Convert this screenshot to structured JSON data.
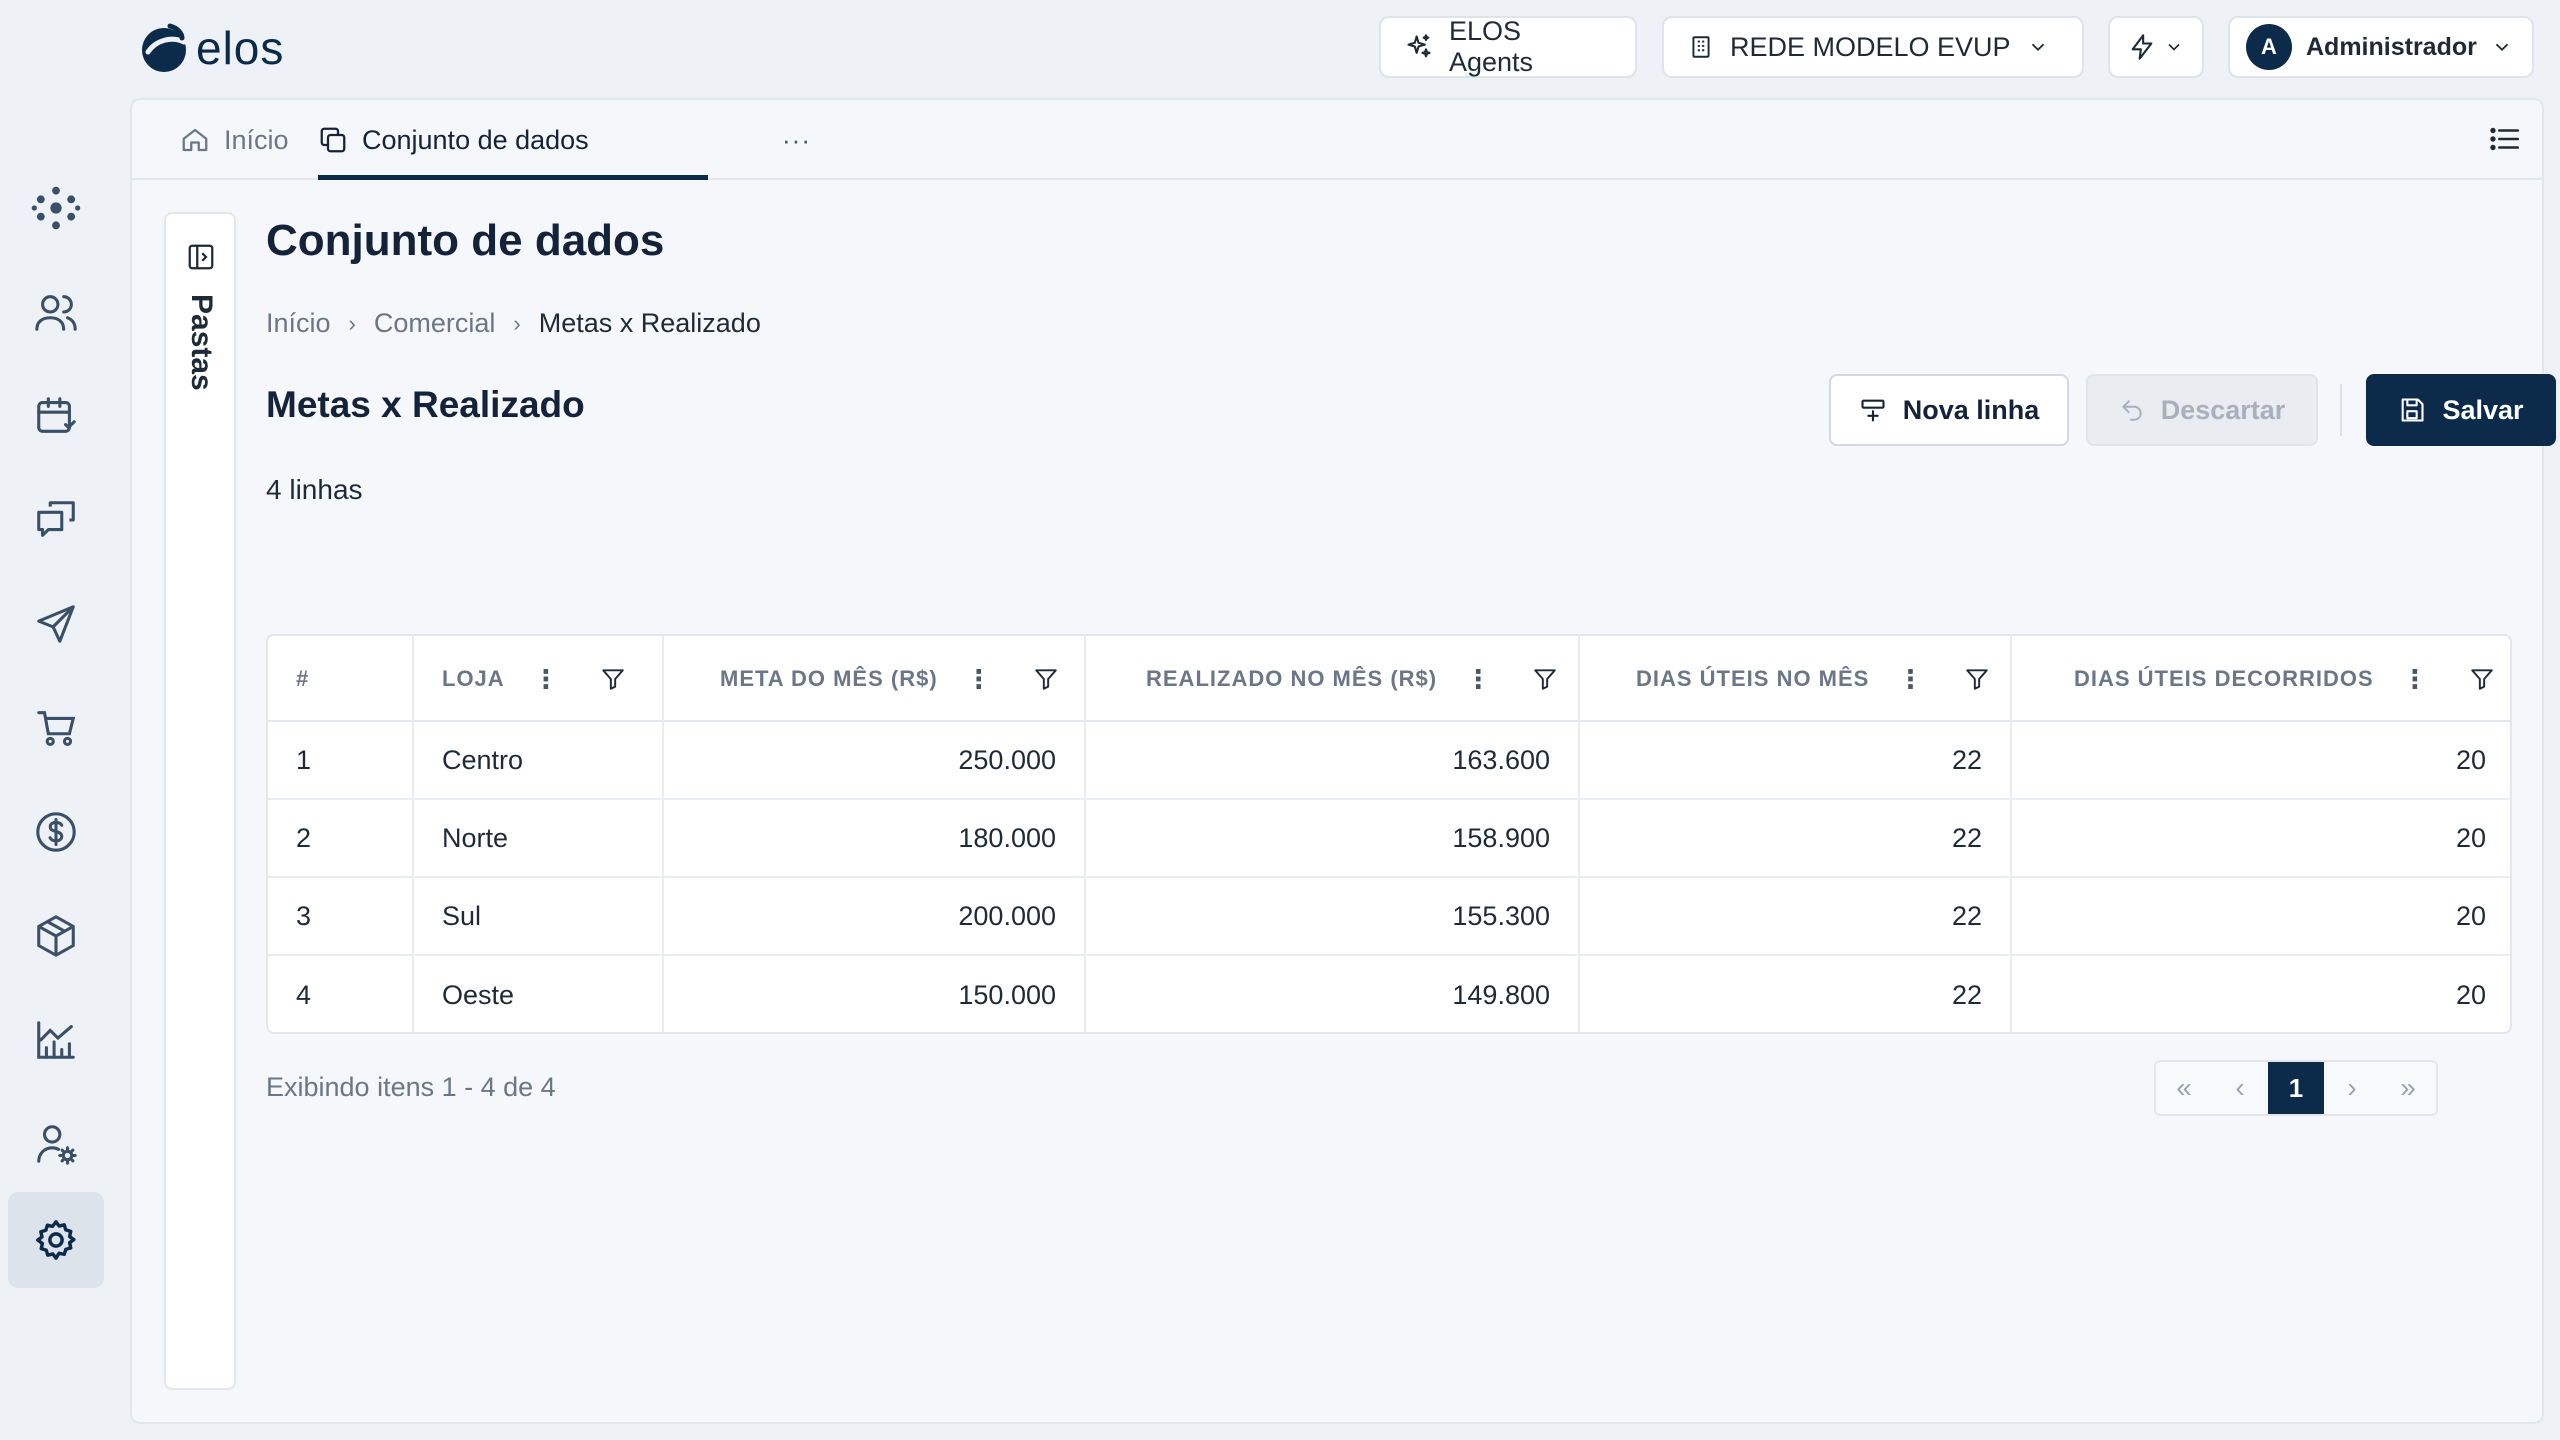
{
  "brand": {
    "name": "elos"
  },
  "topbar": {
    "agents_label": "ELOS Agents",
    "network_label": "REDE MODELO EVUP",
    "user_initial": "A",
    "user_name": "Administrador"
  },
  "rail": {
    "items": [
      "network-icon",
      "users-icon",
      "calendar-icon",
      "chat-icon",
      "send-icon",
      "cart-icon",
      "dollar-icon",
      "box-icon",
      "analytics-icon",
      "user-settings-icon",
      "gear-icon"
    ],
    "active": "gear-icon"
  },
  "tabs": {
    "home_label": "Início",
    "dataset_label": "Conjunto de dados",
    "more_label": "···"
  },
  "folders": {
    "label": "Pastas"
  },
  "page": {
    "title": "Conjunto de dados",
    "breadcrumb": [
      "Início",
      "Comercial",
      "Metas x Realizado"
    ],
    "section_title": "Metas x Realizado",
    "row_count": "4 linhas"
  },
  "actions": {
    "new_row": "Nova linha",
    "discard": "Descartar",
    "save": "Salvar",
    "more": "···"
  },
  "table": {
    "columns": [
      "#",
      "LOJA",
      "META DO MÊS (R$)",
      "REALIZADO NO MÊS (R$)",
      "DIAS ÚTEIS NO MÊS",
      "DIAS ÚTEIS DECORRIDOS"
    ],
    "rows": [
      [
        "1",
        "Centro",
        "250.000",
        "163.600",
        "22",
        "20"
      ],
      [
        "2",
        "Norte",
        "180.000",
        "158.900",
        "22",
        "20"
      ],
      [
        "3",
        "Sul",
        "200.000",
        "155.300",
        "22",
        "20"
      ],
      [
        "4",
        "Oeste",
        "150.000",
        "149.800",
        "22",
        "20"
      ]
    ]
  },
  "footer": {
    "showing": "Exibindo itens 1 - 4 de 4",
    "current_page": "1"
  },
  "colors": {
    "primary": "#0c2b4b",
    "background": "#eef1f5"
  }
}
